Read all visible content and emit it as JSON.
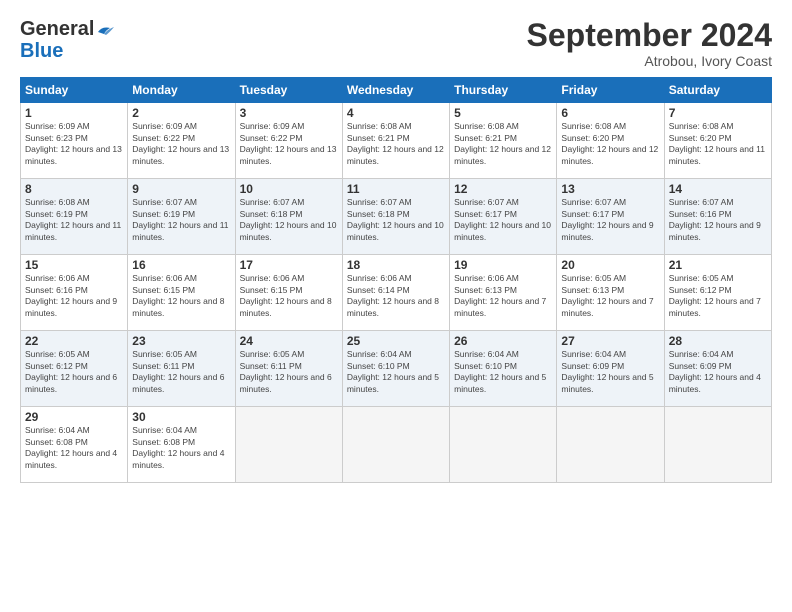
{
  "header": {
    "logo_line1": "General",
    "logo_line2": "Blue",
    "month": "September 2024",
    "location": "Atrobou, Ivory Coast"
  },
  "days_of_week": [
    "Sunday",
    "Monday",
    "Tuesday",
    "Wednesday",
    "Thursday",
    "Friday",
    "Saturday"
  ],
  "weeks": [
    [
      {
        "day": "1",
        "rise": "6:09 AM",
        "set": "6:23 PM",
        "daylight": "12 hours and 13 minutes."
      },
      {
        "day": "2",
        "rise": "6:09 AM",
        "set": "6:22 PM",
        "daylight": "12 hours and 13 minutes."
      },
      {
        "day": "3",
        "rise": "6:09 AM",
        "set": "6:22 PM",
        "daylight": "12 hours and 13 minutes."
      },
      {
        "day": "4",
        "rise": "6:08 AM",
        "set": "6:21 PM",
        "daylight": "12 hours and 12 minutes."
      },
      {
        "day": "5",
        "rise": "6:08 AM",
        "set": "6:21 PM",
        "daylight": "12 hours and 12 minutes."
      },
      {
        "day": "6",
        "rise": "6:08 AM",
        "set": "6:20 PM",
        "daylight": "12 hours and 12 minutes."
      },
      {
        "day": "7",
        "rise": "6:08 AM",
        "set": "6:20 PM",
        "daylight": "12 hours and 11 minutes."
      }
    ],
    [
      {
        "day": "8",
        "rise": "6:08 AM",
        "set": "6:19 PM",
        "daylight": "12 hours and 11 minutes."
      },
      {
        "day": "9",
        "rise": "6:07 AM",
        "set": "6:19 PM",
        "daylight": "12 hours and 11 minutes."
      },
      {
        "day": "10",
        "rise": "6:07 AM",
        "set": "6:18 PM",
        "daylight": "12 hours and 10 minutes."
      },
      {
        "day": "11",
        "rise": "6:07 AM",
        "set": "6:18 PM",
        "daylight": "12 hours and 10 minutes."
      },
      {
        "day": "12",
        "rise": "6:07 AM",
        "set": "6:17 PM",
        "daylight": "12 hours and 10 minutes."
      },
      {
        "day": "13",
        "rise": "6:07 AM",
        "set": "6:17 PM",
        "daylight": "12 hours and 9 minutes."
      },
      {
        "day": "14",
        "rise": "6:07 AM",
        "set": "6:16 PM",
        "daylight": "12 hours and 9 minutes."
      }
    ],
    [
      {
        "day": "15",
        "rise": "6:06 AM",
        "set": "6:16 PM",
        "daylight": "12 hours and 9 minutes."
      },
      {
        "day": "16",
        "rise": "6:06 AM",
        "set": "6:15 PM",
        "daylight": "12 hours and 8 minutes."
      },
      {
        "day": "17",
        "rise": "6:06 AM",
        "set": "6:15 PM",
        "daylight": "12 hours and 8 minutes."
      },
      {
        "day": "18",
        "rise": "6:06 AM",
        "set": "6:14 PM",
        "daylight": "12 hours and 8 minutes."
      },
      {
        "day": "19",
        "rise": "6:06 AM",
        "set": "6:13 PM",
        "daylight": "12 hours and 7 minutes."
      },
      {
        "day": "20",
        "rise": "6:05 AM",
        "set": "6:13 PM",
        "daylight": "12 hours and 7 minutes."
      },
      {
        "day": "21",
        "rise": "6:05 AM",
        "set": "6:12 PM",
        "daylight": "12 hours and 7 minutes."
      }
    ],
    [
      {
        "day": "22",
        "rise": "6:05 AM",
        "set": "6:12 PM",
        "daylight": "12 hours and 6 minutes."
      },
      {
        "day": "23",
        "rise": "6:05 AM",
        "set": "6:11 PM",
        "daylight": "12 hours and 6 minutes."
      },
      {
        "day": "24",
        "rise": "6:05 AM",
        "set": "6:11 PM",
        "daylight": "12 hours and 6 minutes."
      },
      {
        "day": "25",
        "rise": "6:04 AM",
        "set": "6:10 PM",
        "daylight": "12 hours and 5 minutes."
      },
      {
        "day": "26",
        "rise": "6:04 AM",
        "set": "6:10 PM",
        "daylight": "12 hours and 5 minutes."
      },
      {
        "day": "27",
        "rise": "6:04 AM",
        "set": "6:09 PM",
        "daylight": "12 hours and 5 minutes."
      },
      {
        "day": "28",
        "rise": "6:04 AM",
        "set": "6:09 PM",
        "daylight": "12 hours and 4 minutes."
      }
    ],
    [
      {
        "day": "29",
        "rise": "6:04 AM",
        "set": "6:08 PM",
        "daylight": "12 hours and 4 minutes."
      },
      {
        "day": "30",
        "rise": "6:04 AM",
        "set": "6:08 PM",
        "daylight": "12 hours and 4 minutes."
      },
      null,
      null,
      null,
      null,
      null
    ]
  ],
  "week_start_offsets": [
    0,
    0,
    0,
    0,
    0
  ]
}
